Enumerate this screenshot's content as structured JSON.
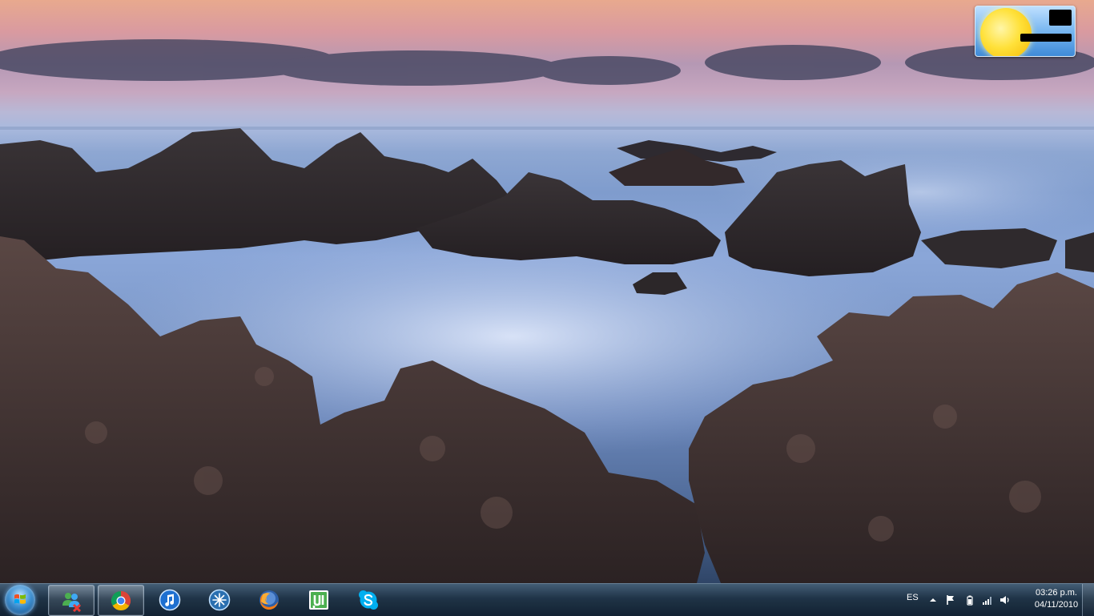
{
  "desktop": {
    "wallpaper": "coastal-rocks-wallpaper"
  },
  "gadget": {
    "icon": "sun-icon"
  },
  "taskbar": {
    "start_icon": "windows-start-orb-icon",
    "items": [
      {
        "name": "msn-messenger",
        "icon": "messenger-people-icon",
        "pinned": true
      },
      {
        "name": "chrome",
        "icon": "chrome-icon",
        "pinned": true
      },
      {
        "name": "itunes",
        "icon": "itunes-icon",
        "pinned": false
      },
      {
        "name": "bluetooth-app",
        "icon": "star-burst-icon",
        "pinned": false
      },
      {
        "name": "firefox",
        "icon": "firefox-icon",
        "pinned": false
      },
      {
        "name": "utorrent",
        "icon": "utorrent-icon",
        "pinned": false
      },
      {
        "name": "skype",
        "icon": "skype-icon",
        "pinned": false
      }
    ],
    "tray": {
      "language": "ES",
      "icons": [
        "show-hidden-icons-arrow-icon",
        "action-center-flag-icon",
        "battery-icon",
        "network-signal-icon",
        "volume-icon"
      ],
      "time": "03:26 p.m.",
      "date": "04/11/2010"
    }
  },
  "colors": {
    "taskbar": "#1b3044",
    "accent": "#3d8fd0"
  }
}
